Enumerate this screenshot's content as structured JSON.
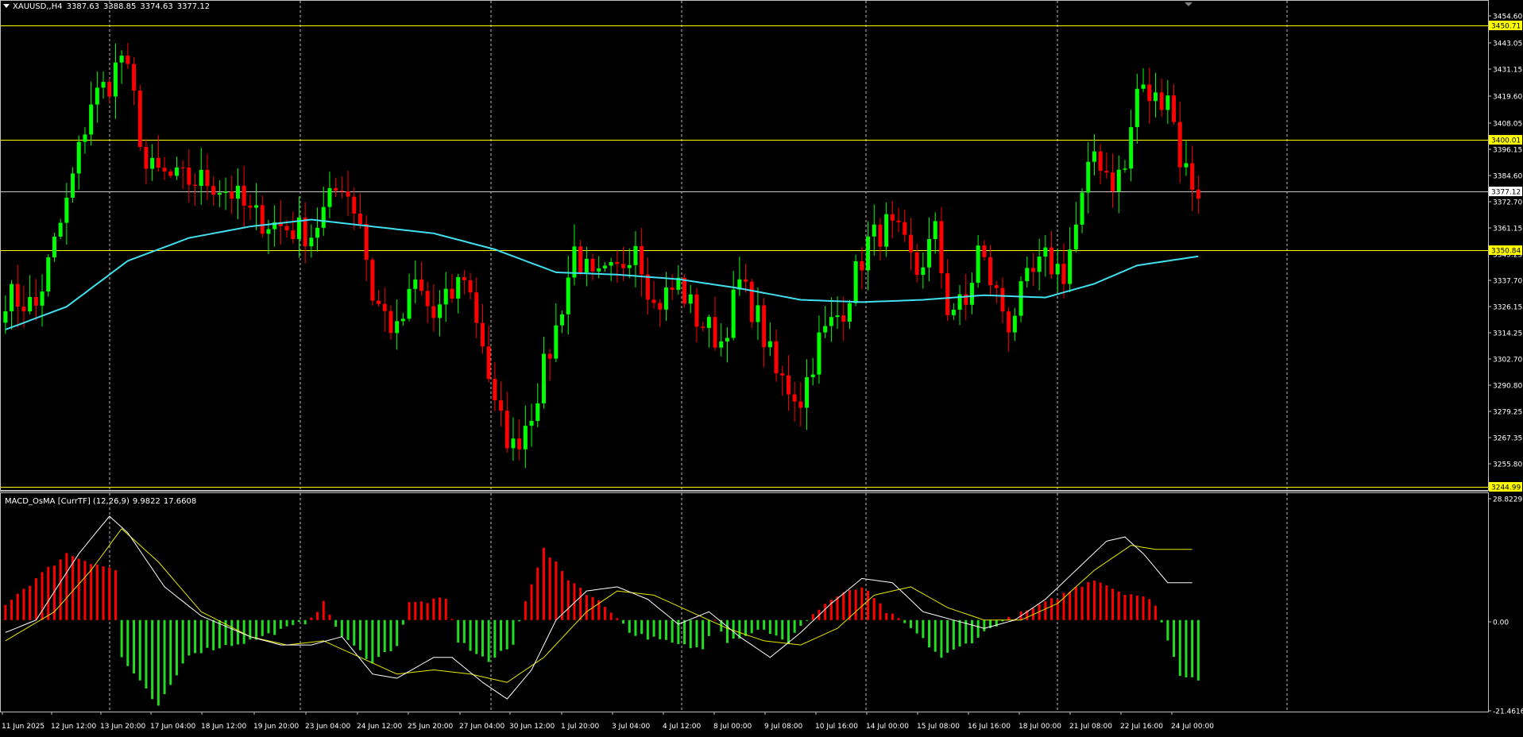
{
  "header": {
    "symbol": "XAUUSD,,H4",
    "open": "3387.63",
    "high": "3388.85",
    "low": "3374.63",
    "close": "3377.12"
  },
  "indicator": {
    "name": "MACD_OsMA [CurrTF] (12,26,9)",
    "value1": "9.9822",
    "value2": "17.6608"
  },
  "colors": {
    "background": "#000000",
    "bull": "#00ff00",
    "bear": "#ff0000",
    "ma": "#40e0f0",
    "level": "#ffff00",
    "grid": "#c0c0c0",
    "hist_up": "#ff0000",
    "hist_down": "#22dd22",
    "macd_line": "#ffffff",
    "signal_line": "#e8e800"
  },
  "price_axis": {
    "ticks": [
      "3454.60",
      "3443.05",
      "3431.15",
      "3419.60",
      "3408.05",
      "3396.15",
      "3384.60",
      "3372.70",
      "3361.15",
      "3349.25",
      "3337.70",
      "3326.15",
      "3314.25",
      "3302.70",
      "3290.80",
      "3279.25",
      "3267.35",
      "3255.80"
    ],
    "levels": [
      "3450.71",
      "3400.01",
      "3377.12",
      "3350.84",
      "3244.99"
    ]
  },
  "osc_axis": {
    "ticks": [
      "28.8229",
      "0.00",
      "-21.4616"
    ]
  },
  "time_axis": {
    "labels": [
      "11 Jun 2025",
      "12 Jun 12:00",
      "13 Jun 20:00",
      "17 Jun 04:00",
      "18 Jun 12:00",
      "19 Jun 20:00",
      "23 Jun 04:00",
      "24 Jun 12:00",
      "25 Jun 20:00",
      "27 Jun 04:00",
      "30 Jun 12:00",
      "1 Jul 20:00",
      "3 Jul 04:00",
      "4 Jul 12:00",
      "8 Jul 00:00",
      "9 Jul 08:00",
      "10 Jul 16:00",
      "14 Jul 00:00",
      "15 Jul 08:00",
      "16 Jul 16:00",
      "18 Jul 00:00",
      "21 Jul 08:00",
      "22 Jul 16:00",
      "24 Jul 00:00"
    ]
  },
  "chart_data": {
    "type": "candlestick",
    "series_keypoints_close": [
      [
        0,
        3335
      ],
      [
        5,
        3330
      ],
      [
        10,
        3375
      ],
      [
        14,
        3420
      ],
      [
        17,
        3428
      ],
      [
        19,
        3440
      ],
      [
        21,
        3420
      ],
      [
        23,
        3390
      ],
      [
        28,
        3385
      ],
      [
        33,
        3385
      ],
      [
        37,
        3380
      ],
      [
        40,
        3370
      ],
      [
        45,
        3365
      ],
      [
        50,
        3362
      ],
      [
        55,
        3385
      ],
      [
        58,
        3368
      ],
      [
        60,
        3335
      ],
      [
        64,
        3318
      ],
      [
        67,
        3340
      ],
      [
        70,
        3325
      ],
      [
        73,
        3335
      ],
      [
        75,
        3345
      ],
      [
        78,
        3315
      ],
      [
        80,
        3285
      ],
      [
        83,
        3268
      ],
      [
        86,
        3285
      ],
      [
        90,
        3320
      ],
      [
        93,
        3355
      ],
      [
        96,
        3340
      ],
      [
        100,
        3345
      ],
      [
        103,
        3360
      ],
      [
        106,
        3330
      ],
      [
        110,
        3340
      ],
      [
        113,
        3325
      ],
      [
        117,
        3315
      ],
      [
        120,
        3340
      ],
      [
        123,
        3325
      ],
      [
        126,
        3300
      ],
      [
        130,
        3290
      ],
      [
        133,
        3315
      ],
      [
        137,
        3330
      ],
      [
        141,
        3358
      ],
      [
        144,
        3365
      ],
      [
        146,
        3360
      ],
      [
        149,
        3345
      ],
      [
        152,
        3362
      ],
      [
        154,
        3330
      ],
      [
        157,
        3330
      ],
      [
        159,
        3355
      ],
      [
        162,
        3335
      ],
      [
        164,
        3323
      ],
      [
        167,
        3340
      ],
      [
        170,
        3350
      ],
      [
        173,
        3345
      ],
      [
        175,
        3365
      ],
      [
        178,
        3398
      ],
      [
        181,
        3385
      ],
      [
        183,
        3390
      ],
      [
        185,
        3425
      ],
      [
        188,
        3420
      ],
      [
        190,
        3425
      ],
      [
        192,
        3395
      ],
      [
        194,
        3384
      ],
      [
        195,
        3377
      ]
    ],
    "ma_keypoints": [
      [
        0,
        3320
      ],
      [
        10,
        3330
      ],
      [
        20,
        3350
      ],
      [
        30,
        3360
      ],
      [
        40,
        3365
      ],
      [
        50,
        3368
      ],
      [
        60,
        3365
      ],
      [
        70,
        3362
      ],
      [
        80,
        3355
      ],
      [
        90,
        3345
      ],
      [
        100,
        3344
      ],
      [
        110,
        3342
      ],
      [
        120,
        3338
      ],
      [
        130,
        3333
      ],
      [
        140,
        3332
      ],
      [
        150,
        3333
      ],
      [
        160,
        3335
      ],
      [
        170,
        3334
      ],
      [
        178,
        3340
      ],
      [
        185,
        3348
      ],
      [
        195,
        3352
      ]
    ],
    "histogram_keypoints": [
      [
        0,
        4
      ],
      [
        10,
        16
      ],
      [
        18,
        12
      ],
      [
        19,
        -9
      ],
      [
        25,
        -21
      ],
      [
        30,
        -8
      ],
      [
        40,
        -5
      ],
      [
        49,
        -0.5
      ],
      [
        52,
        4
      ],
      [
        55,
        -4
      ],
      [
        60,
        -10
      ],
      [
        64,
        -6
      ],
      [
        66,
        4
      ],
      [
        72,
        5
      ],
      [
        74,
        -5
      ],
      [
        79,
        -10
      ],
      [
        83,
        -6
      ],
      [
        85,
        5
      ],
      [
        88,
        17
      ],
      [
        92,
        10
      ],
      [
        100,
        1
      ],
      [
        102,
        -3
      ],
      [
        110,
        -6
      ],
      [
        114,
        -7
      ],
      [
        116,
        0.5
      ],
      [
        118,
        -5
      ],
      [
        124,
        -2
      ],
      [
        128,
        -6
      ],
      [
        130,
        -1
      ],
      [
        135,
        5
      ],
      [
        140,
        8
      ],
      [
        144,
        2
      ],
      [
        148,
        -2
      ],
      [
        153,
        -9
      ],
      [
        158,
        -5
      ],
      [
        162,
        -1
      ],
      [
        170,
        4
      ],
      [
        178,
        10
      ],
      [
        182,
        7
      ],
      [
        185,
        6
      ],
      [
        188,
        4
      ],
      [
        190,
        -5
      ],
      [
        192,
        -13
      ],
      [
        195,
        -14
      ]
    ],
    "macd_keypoints": [
      [
        0,
        -3
      ],
      [
        5,
        0
      ],
      [
        12,
        16
      ],
      [
        17,
        25
      ],
      [
        20,
        21
      ],
      [
        26,
        8
      ],
      [
        32,
        1
      ],
      [
        40,
        -4
      ],
      [
        45,
        -6
      ],
      [
        50,
        -6
      ],
      [
        55,
        -4
      ],
      [
        60,
        -13
      ],
      [
        64,
        -14
      ],
      [
        70,
        -9
      ],
      [
        73,
        -9
      ],
      [
        78,
        -15
      ],
      [
        82,
        -19
      ],
      [
        86,
        -12
      ],
      [
        90,
        0
      ],
      [
        95,
        7
      ],
      [
        100,
        8
      ],
      [
        105,
        5
      ],
      [
        110,
        -1
      ],
      [
        115,
        2
      ],
      [
        120,
        -4
      ],
      [
        125,
        -9
      ],
      [
        130,
        -3
      ],
      [
        135,
        4
      ],
      [
        140,
        10
      ],
      [
        145,
        9
      ],
      [
        150,
        2
      ],
      [
        155,
        0
      ],
      [
        160,
        -2
      ],
      [
        165,
        0
      ],
      [
        170,
        5
      ],
      [
        175,
        12
      ],
      [
        180,
        19
      ],
      [
        183,
        20
      ],
      [
        186,
        16
      ],
      [
        190,
        9
      ]
    ],
    "signal_keypoints": [
      [
        0,
        -5
      ],
      [
        8,
        2
      ],
      [
        14,
        12
      ],
      [
        19,
        22
      ],
      [
        25,
        14
      ],
      [
        32,
        2
      ],
      [
        40,
        -4
      ],
      [
        46,
        -6
      ],
      [
        52,
        -5
      ],
      [
        58,
        -9
      ],
      [
        64,
        -13
      ],
      [
        70,
        -12
      ],
      [
        76,
        -13
      ],
      [
        82,
        -15
      ],
      [
        88,
        -9
      ],
      [
        95,
        2
      ],
      [
        100,
        7
      ],
      [
        106,
        6
      ],
      [
        112,
        2
      ],
      [
        118,
        -2
      ],
      [
        124,
        -5
      ],
      [
        130,
        -6
      ],
      [
        136,
        -2
      ],
      [
        142,
        6
      ],
      [
        148,
        8
      ],
      [
        154,
        3
      ],
      [
        160,
        0
      ],
      [
        166,
        0
      ],
      [
        172,
        4
      ],
      [
        178,
        12
      ],
      [
        184,
        18
      ],
      [
        188,
        17
      ]
    ]
  }
}
